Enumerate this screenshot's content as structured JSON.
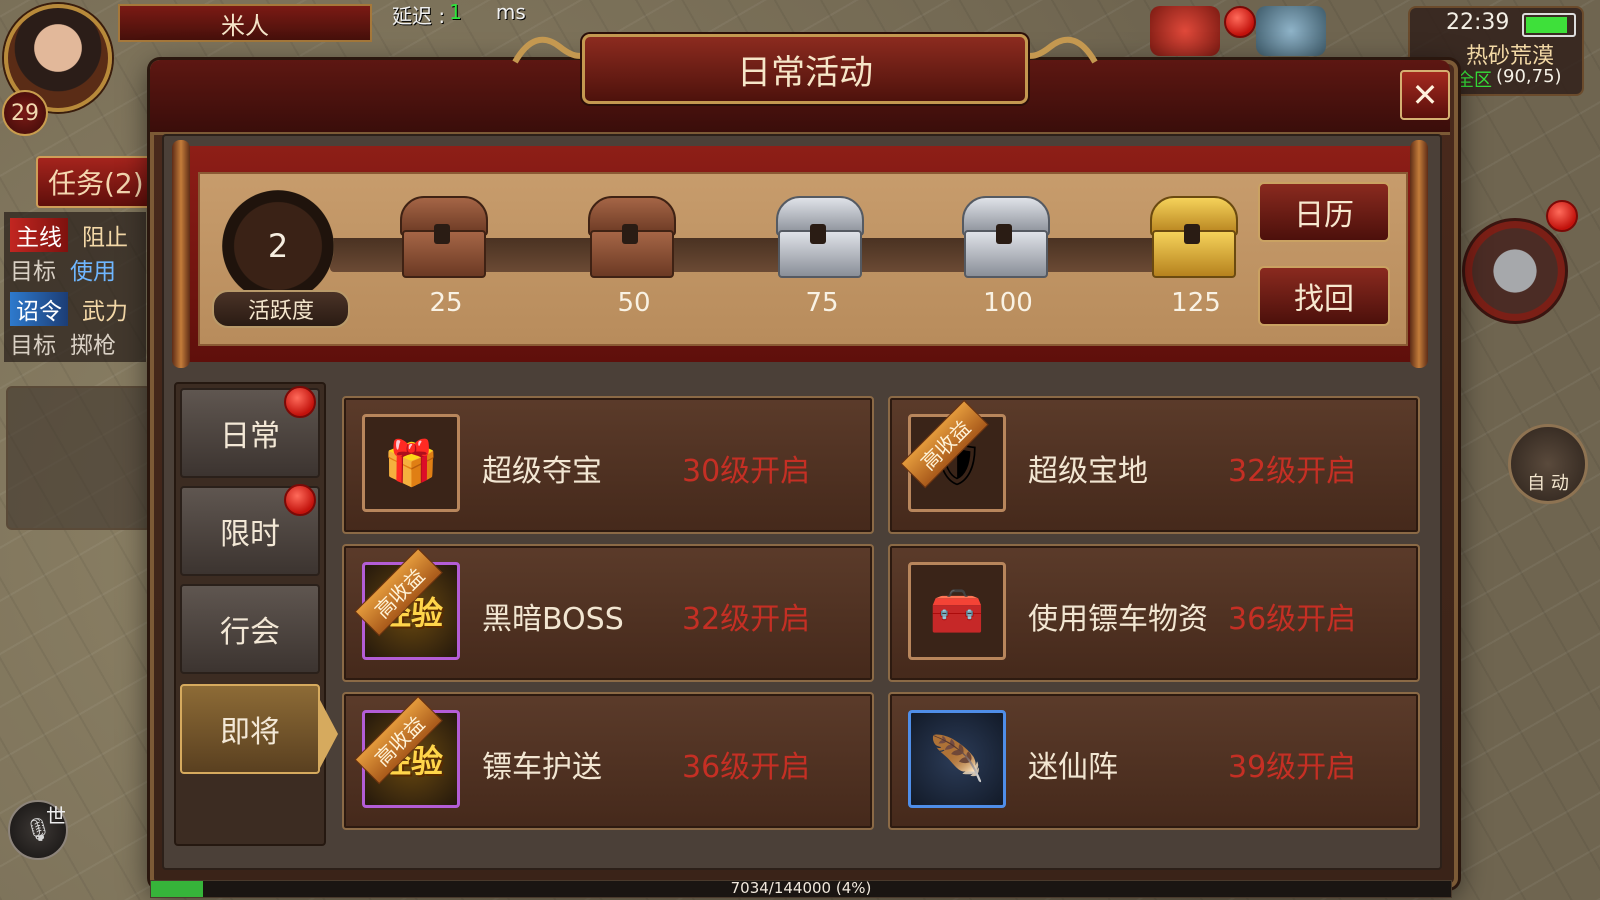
{
  "hud": {
    "player_name": "米人",
    "level": "29",
    "latency_label": "延迟 :",
    "latency_value": "1",
    "latency_unit": "ms",
    "quest_tab": "任务(2)",
    "quests": [
      {
        "tag": "主线",
        "text": "阻止"
      },
      {
        "tag": "目标",
        "text": "使用"
      },
      {
        "tag": "诏令",
        "text": "武力"
      },
      {
        "tag": "目标",
        "text": "掷枪"
      }
    ],
    "clock": "22:39",
    "battery_level": 0.9,
    "map_name": "热砂荒漠",
    "map_zone": "全区",
    "map_coords": "(90,75)",
    "auto_label": "自 动",
    "chat_channel": "世",
    "exp_text": "7034/144000 (4%)",
    "exp_fraction": 0.04
  },
  "dialog": {
    "title": "日常活动",
    "close_symbol": "✕",
    "activity": {
      "value": "2",
      "label": "活跃度",
      "chests": [
        {
          "value": "25",
          "kind": "bronze"
        },
        {
          "value": "50",
          "kind": "bronze"
        },
        {
          "value": "75",
          "kind": "silver"
        },
        {
          "value": "100",
          "kind": "silver"
        },
        {
          "value": "125",
          "kind": "gold"
        }
      ]
    },
    "side_buttons": {
      "calendar": "日历",
      "retrieve": "找回"
    },
    "tabs": [
      {
        "label": "日常",
        "badge": true,
        "active": false
      },
      {
        "label": "限时",
        "badge": true,
        "active": false
      },
      {
        "label": "行会",
        "badge": false,
        "active": false
      },
      {
        "label": "即将",
        "badge": false,
        "active": true
      }
    ],
    "cards": [
      {
        "name": "超级夺宝",
        "requirement": "30级开启",
        "icon": "treasure-chest-icon",
        "ribbon": ""
      },
      {
        "name": "超级宝地",
        "requirement": "32级开启",
        "icon": "armor-icon",
        "ribbon": "高收益"
      },
      {
        "name": "黑暗BOSS",
        "requirement": "32级开启",
        "icon": "exp-icon",
        "ribbon": "高收益",
        "icon_text": "经验"
      },
      {
        "name": "使用镖车物资",
        "requirement": "36级开启",
        "icon": "treasure-chest-icon",
        "ribbon": ""
      },
      {
        "name": "镖车护送",
        "requirement": "36级开启",
        "icon": "exp-icon",
        "ribbon": "高收益",
        "icon_text": "经验"
      },
      {
        "name": "迷仙阵",
        "requirement": "39级开启",
        "icon": "feather-icon",
        "ribbon": ""
      }
    ]
  }
}
